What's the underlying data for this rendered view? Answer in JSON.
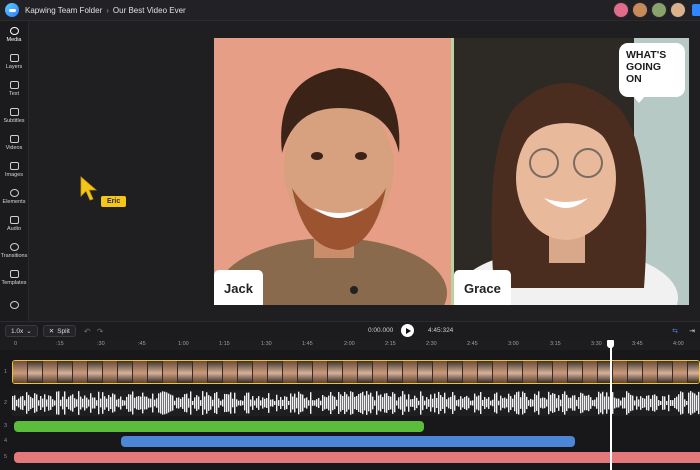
{
  "header": {
    "breadcrumb": [
      "Kapwing Team Folder",
      "Our Best Video Ever"
    ],
    "separator": "›",
    "avatar_colors": [
      "#e06b8a",
      "#c98a5a",
      "#8aa36a",
      "#d9b28a"
    ],
    "accent": "#2f86ff"
  },
  "sidebar": {
    "items": [
      {
        "label": "Media",
        "icon": "cloud-upload-icon"
      },
      {
        "label": "Layers",
        "icon": "layers-icon"
      },
      {
        "label": "Text",
        "icon": "text-icon"
      },
      {
        "label": "Subtitles",
        "icon": "subtitles-icon"
      },
      {
        "label": "Videos",
        "icon": "film-icon"
      },
      {
        "label": "Images",
        "icon": "image-icon"
      },
      {
        "label": "Elements",
        "icon": "shapes-icon"
      },
      {
        "label": "Audio",
        "icon": "music-note-icon"
      },
      {
        "label": "Transitions",
        "icon": "transition-icon"
      },
      {
        "label": "Templates",
        "icon": "grid-icon"
      },
      {
        "label": "",
        "icon": "plugin-icon"
      }
    ]
  },
  "canvas": {
    "collaborator_cursor": {
      "name": "Eric",
      "color": "#f5c518"
    },
    "video": {
      "left_name": "Jack",
      "right_name": "Grace",
      "bubble_text": "WHAT'S GOING ON"
    }
  },
  "timeline": {
    "speed": "1.0x",
    "split_label": "Split",
    "current_time": "0:00.000",
    "total_time": "4:45:324",
    "ruler": [
      "0",
      ":15",
      ":30",
      ":45",
      "1:00",
      "1:15",
      "1:30",
      "1:45",
      "2:00",
      "2:15",
      "2:30",
      "2:45",
      "3:00",
      "3:15",
      "3:30",
      "3:45",
      "4:00"
    ],
    "row_numbers": [
      "1",
      "2",
      "3",
      "4",
      "5"
    ],
    "track_colors": {
      "video_border": "#f2c230",
      "green": "#5bbd3b",
      "blue": "#4c86d6",
      "pink": "#e5787a"
    }
  }
}
